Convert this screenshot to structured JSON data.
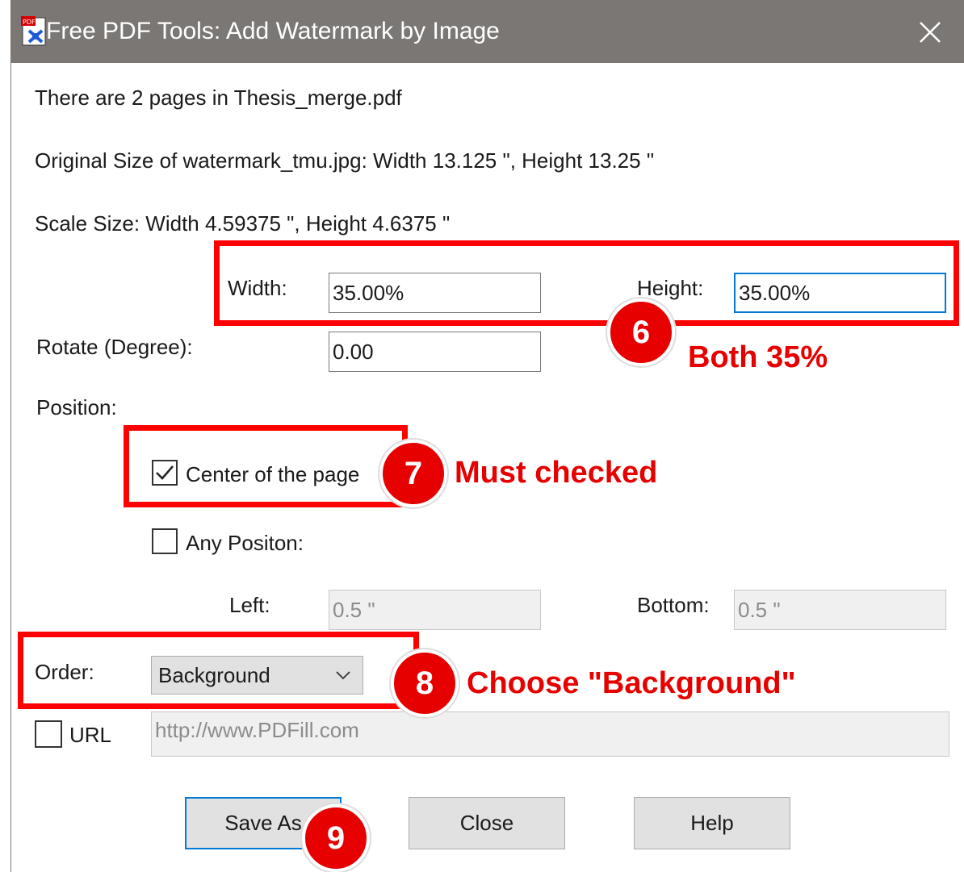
{
  "window": {
    "title": "Free PDF Tools: Add Watermark by Image",
    "icons": {
      "app": "pdf-tools-icon",
      "close": "close-icon"
    }
  },
  "info": {
    "pages_line": "There are 2 pages in Thesis_merge.pdf",
    "original_size_line": "Original Size of watermark_tmu.jpg:  Width 13.125 \",   Height 13.25 \"",
    "scale_size_line": "Scale Size:  Width 4.59375 \",   Height 4.6375 \""
  },
  "form": {
    "width_label": "Width:",
    "width_value": "35.00%",
    "height_label": "Height:",
    "height_value": "35.00%",
    "rotate_label": "Rotate (Degree):",
    "rotate_value": "0.00",
    "position_label": "Position:",
    "center_label": "Center of the page",
    "center_checked": true,
    "any_position_label": "Any Positon:",
    "any_position_checked": false,
    "left_label": "Left:",
    "left_value": "0.5 \"",
    "bottom_label": "Bottom:",
    "bottom_value": "0.5 \"",
    "order_label": "Order:",
    "order_value": "Background",
    "url_label": "URL",
    "url_checked": false,
    "url_value": "http://www.PDFill.com"
  },
  "buttons": {
    "save_as": "Save As",
    "close": "Close",
    "help": "Help"
  },
  "annotations": {
    "step6": "6",
    "step6_note": "Both 35%",
    "step7": "7",
    "step7_note": "Must checked",
    "step8": "8",
    "step8_note": "Choose \"Background\"",
    "step9": "9",
    "color": "#e60000"
  }
}
